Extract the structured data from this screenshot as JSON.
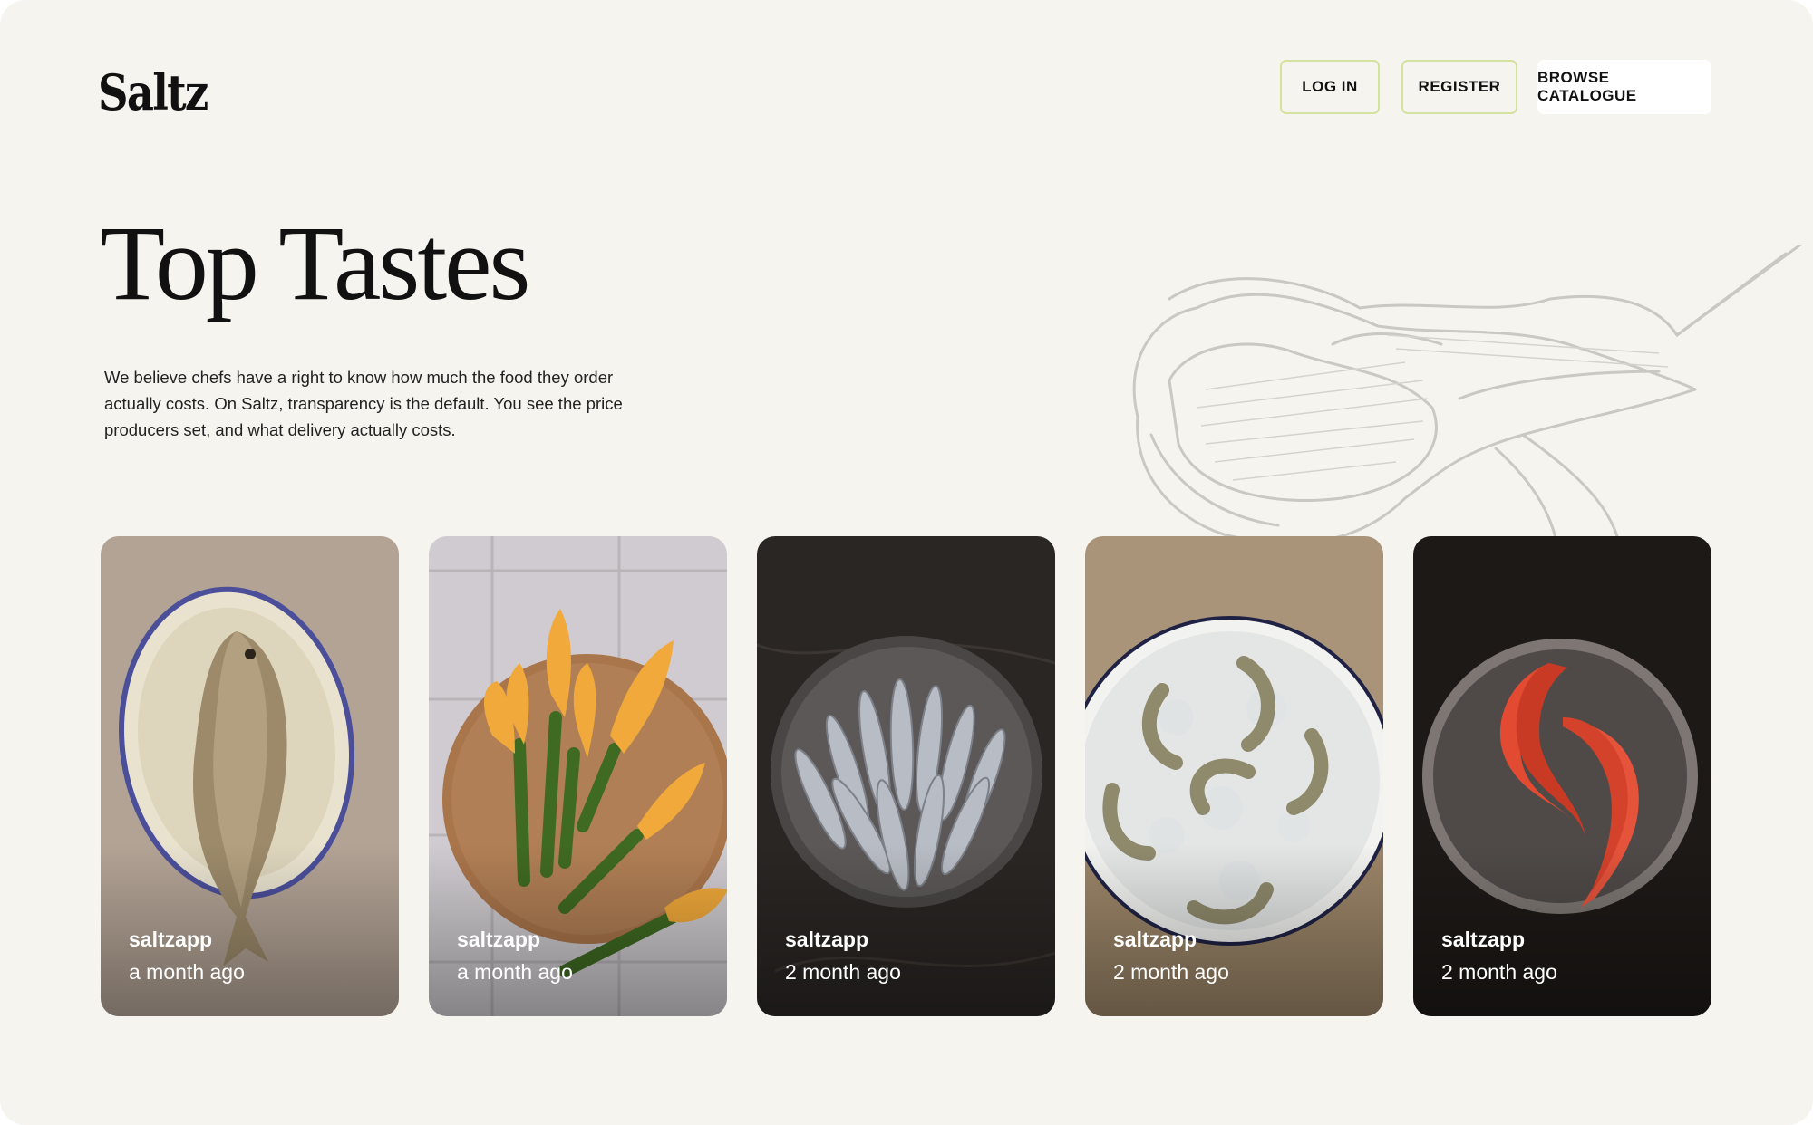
{
  "brand": {
    "name": "Saltz"
  },
  "nav": {
    "login_label": "LOG IN",
    "register_label": "REGISTER",
    "browse_label": "BROWSE CATALOGUE"
  },
  "hero": {
    "title": "Top Tastes",
    "description": "We believe chefs have a right to know how much the food they order actually costs. On Saltz, transparency is the default. You see the price producers set, and what delivery actually costs."
  },
  "colors": {
    "background": "#f5f4ef",
    "button_outline": "#d3e29c",
    "text": "#111111"
  },
  "cards": [
    {
      "author": "saltzapp",
      "time": "a month ago",
      "subject": "fish-on-oval-plate"
    },
    {
      "author": "saltzapp",
      "time": "a month ago",
      "subject": "zucchini-flowers-on-board"
    },
    {
      "author": "saltzapp",
      "time": "2 month ago",
      "subject": "sardines-on-plate"
    },
    {
      "author": "saltzapp",
      "time": "2 month ago",
      "subject": "prawns-on-ice"
    },
    {
      "author": "saltzapp",
      "time": "2 month ago",
      "subject": "red-mullet-on-plate"
    }
  ]
}
